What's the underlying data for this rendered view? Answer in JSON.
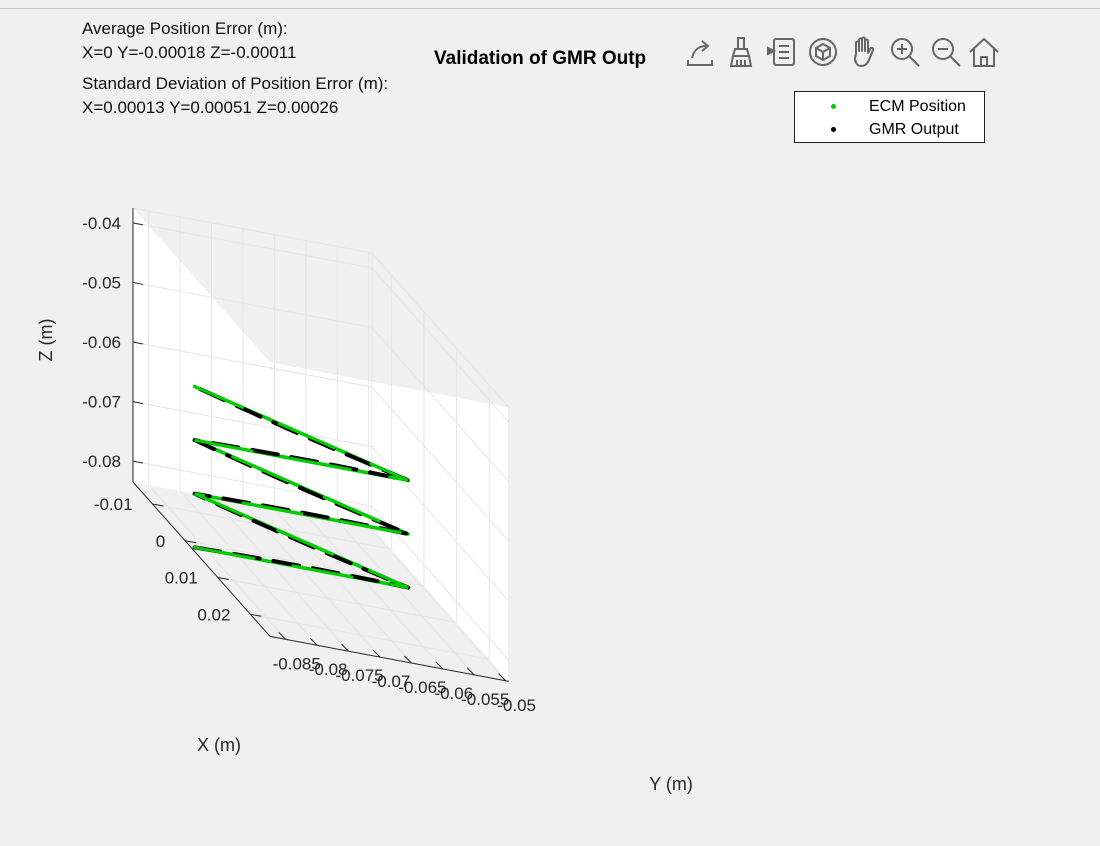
{
  "annotations": {
    "avg_title": "Average Position Error (m):",
    "avg_values": "X=0 Y=-0.00018 Z=-0.00011",
    "std_title": "Standard Deviation of Position Error (m):",
    "std_values": "X=0.00013 Y=0.00051 Z=0.00026"
  },
  "toolbar": {
    "icons": [
      "export-icon",
      "brush-icon",
      "data-tip-icon",
      "rotate-3d-icon",
      "pan-icon",
      "zoom-in-icon",
      "zoom-out-icon",
      "home-icon"
    ]
  },
  "colors": {
    "ecm": "#00cc00",
    "gmr": "#000000",
    "grid": "#e6e6e6",
    "axis": "#262626",
    "background": "#f0f0f0"
  },
  "chart_data": {
    "type": "scatter",
    "projection": "3d",
    "title": "Validation of GMR Outp",
    "xlabel": "X (m)",
    "ylabel": "Y (m)",
    "zlabel": "Z (m)",
    "x_ticks": [
      "-0.01",
      "0",
      "0.01",
      "0.02"
    ],
    "y_ticks": [
      "-0.085",
      "-0.08",
      "-0.075",
      "-0.07",
      "-0.065",
      "-0.06",
      "-0.055",
      "-0.05"
    ],
    "z_ticks": [
      "-0.04",
      "-0.05",
      "-0.06",
      "-0.07",
      "-0.08"
    ],
    "grid": true,
    "legend": {
      "position": "top-right",
      "entries": [
        "ECM Position",
        "GMR Output"
      ]
    },
    "series": [
      {
        "name": "ECM Position",
        "color": "#00cc00",
        "vertices": [
          {
            "y": -0.086,
            "z": -0.0843
          },
          {
            "y": -0.052,
            "z": -0.0843
          },
          {
            "y": -0.086,
            "z": -0.0753
          },
          {
            "y": -0.052,
            "z": -0.0753
          },
          {
            "y": -0.086,
            "z": -0.0663
          },
          {
            "y": -0.052,
            "z": -0.0663
          },
          {
            "y": -0.086,
            "z": -0.0573
          }
        ]
      },
      {
        "name": "GMR Output",
        "color": "#000000",
        "vertices": [
          {
            "y": -0.086,
            "z": -0.0843
          },
          {
            "y": -0.052,
            "z": -0.0843
          },
          {
            "y": -0.086,
            "z": -0.0753
          },
          {
            "y": -0.052,
            "z": -0.0753
          },
          {
            "y": -0.086,
            "z": -0.0663
          },
          {
            "y": -0.052,
            "z": -0.0663
          },
          {
            "y": -0.086,
            "z": -0.0573
          }
        ]
      }
    ]
  }
}
